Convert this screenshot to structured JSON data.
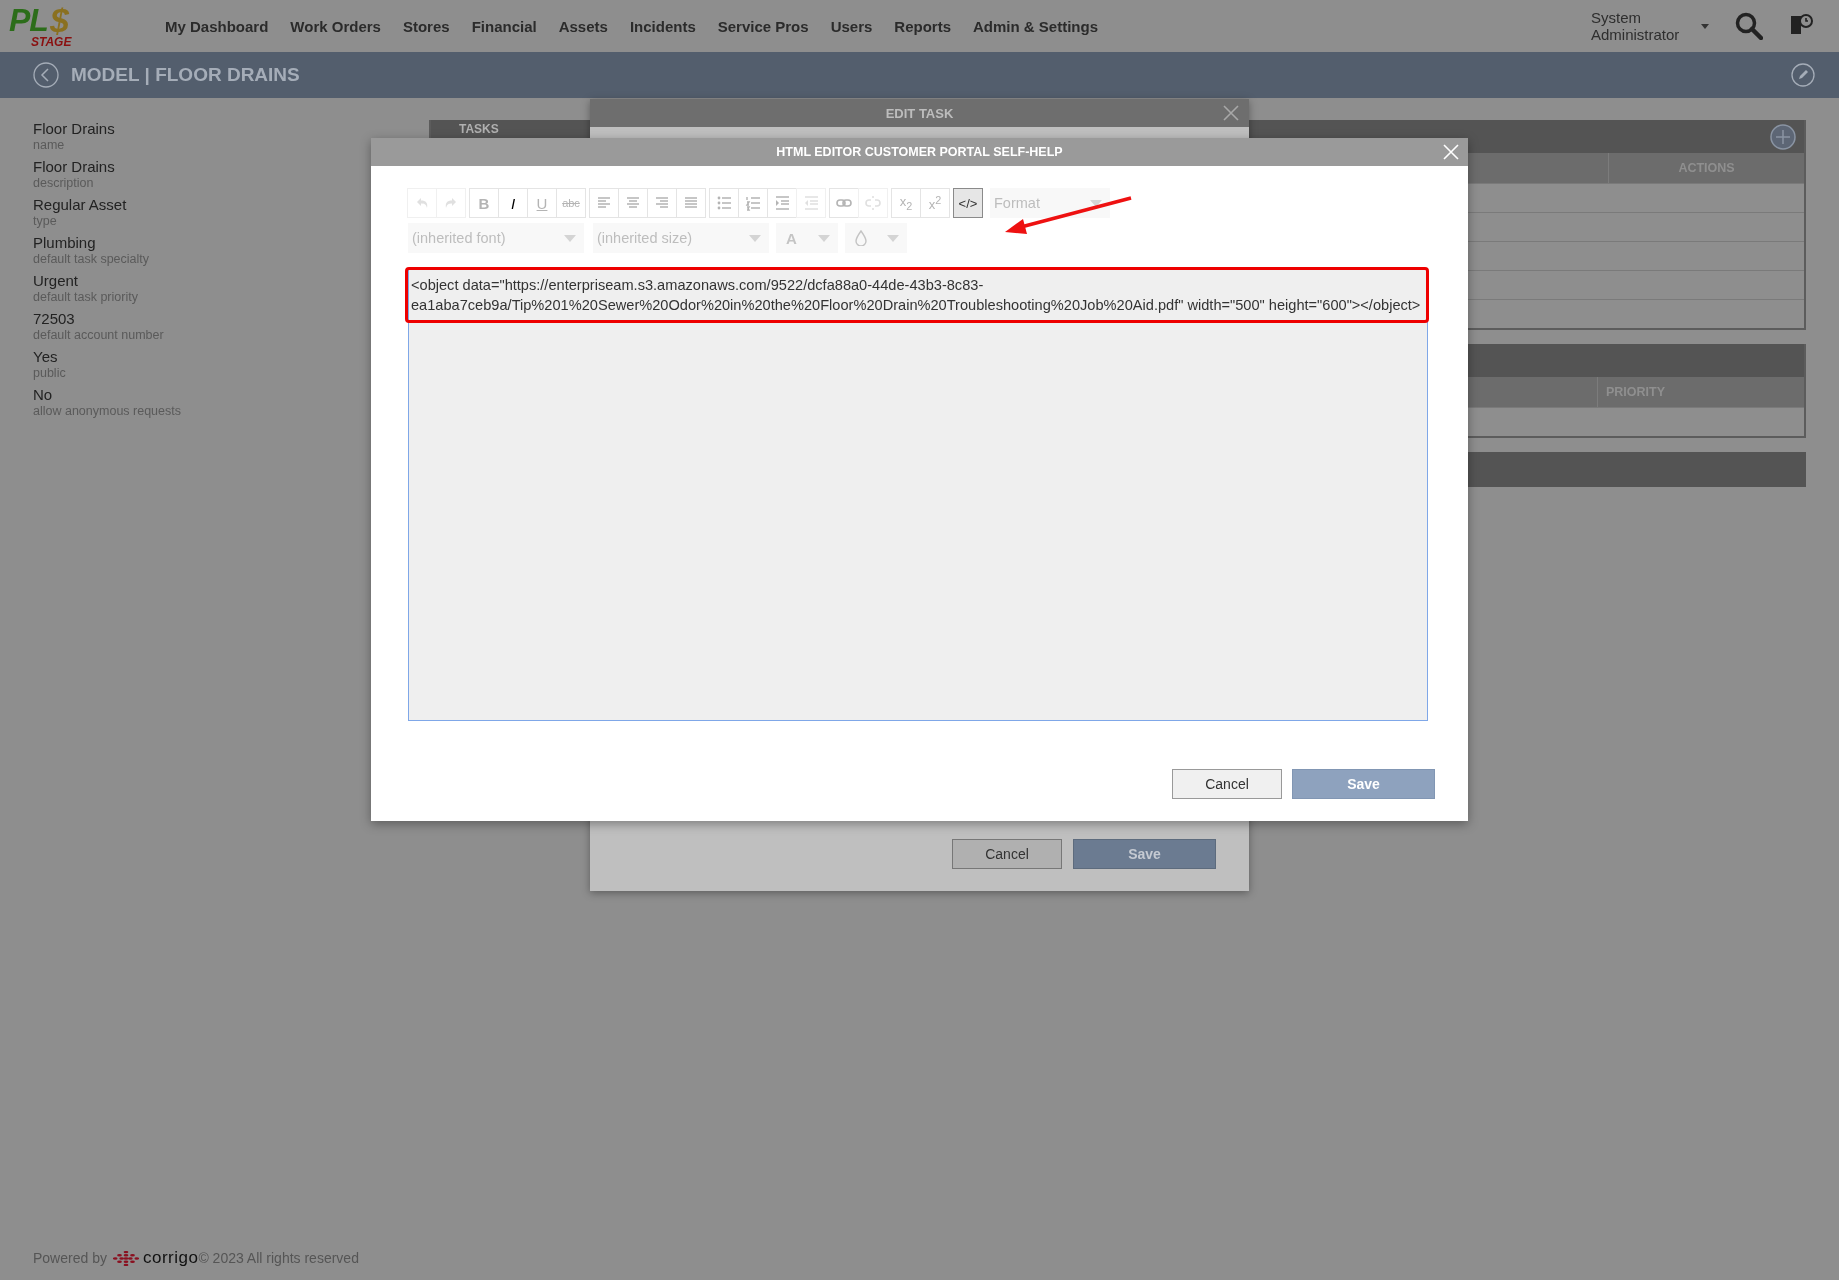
{
  "nav": {
    "logo": {
      "letters": "PL",
      "symbol": "$",
      "badge": "STAGE"
    },
    "items": [
      "My Dashboard",
      "Work Orders",
      "Stores",
      "Financial",
      "Assets",
      "Incidents",
      "Service Pros",
      "Users",
      "Reports",
      "Admin & Settings"
    ],
    "user": "System Administrator"
  },
  "header": {
    "title": "MODEL | FLOOR DRAINS"
  },
  "details": [
    {
      "value": "Floor Drains",
      "label": "name"
    },
    {
      "value": "Floor Drains",
      "label": "description"
    },
    {
      "value": "Regular Asset",
      "label": "type"
    },
    {
      "value": "Plumbing",
      "label": "default task specialty"
    },
    {
      "value": "Urgent",
      "label": "default task priority"
    },
    {
      "value": "72503",
      "label": "default account number"
    },
    {
      "value": "Yes",
      "label": "public"
    },
    {
      "value": "No",
      "label": "allow anonymous requests"
    }
  ],
  "panels": [
    {
      "kind": "table",
      "heading": "TASKS",
      "column": "ACTIONS"
    },
    {
      "kind": "table",
      "column": "PRIORITY"
    },
    {
      "kind": "bar"
    }
  ],
  "edit_task": {
    "title": "EDIT TASK",
    "buttons": [
      {
        "label": "Cancel",
        "kind": "secondary"
      },
      {
        "label": "Save",
        "kind": "primary"
      }
    ]
  },
  "html_editor": {
    "title": "HTML EDITOR CUSTOMER PORTAL SELF-HELP",
    "toolbar": [
      [
        {
          "kind": "group",
          "buttons": [
            {
              "kind": "undo",
              "disabled": true,
              "selected": false
            },
            {
              "kind": "redo",
              "disabled": true,
              "selected": false
            }
          ]
        },
        {
          "kind": "group",
          "buttons": [
            {
              "kind": "bold",
              "label": "B",
              "disabled": false,
              "selected": false
            },
            {
              "kind": "italic",
              "label": "I",
              "disabled": false,
              "selected": false
            },
            {
              "kind": "underline",
              "label": "U",
              "disabled": false,
              "selected": false
            },
            {
              "kind": "strike",
              "label": "abc",
              "disabled": false,
              "selected": false
            }
          ]
        },
        {
          "kind": "group",
          "buttons": [
            {
              "kind": "align-left",
              "disabled": false,
              "selected": false
            },
            {
              "kind": "align-center",
              "disabled": false,
              "selected": false
            },
            {
              "kind": "align-right",
              "disabled": false,
              "selected": false
            },
            {
              "kind": "justify",
              "disabled": false,
              "selected": false
            }
          ]
        },
        {
          "kind": "group",
          "buttons": [
            {
              "kind": "bullet-list",
              "disabled": false,
              "selected": false
            },
            {
              "kind": "numbered-list",
              "disabled": false,
              "selected": false
            },
            {
              "kind": "indent",
              "disabled": false,
              "selected": false
            },
            {
              "kind": "outdent",
              "disabled": true,
              "selected": false
            }
          ]
        },
        {
          "kind": "group",
          "buttons": [
            {
              "kind": "link",
              "disabled": false,
              "selected": false
            },
            {
              "kind": "unlink",
              "disabled": true,
              "selected": false
            }
          ]
        },
        {
          "kind": "group",
          "buttons": [
            {
              "kind": "subscript",
              "label": "x$_{2}$",
              "disabled": false,
              "selected": false
            },
            {
              "kind": "superscript",
              "label": "x$^{2}$",
              "disabled": false,
              "selected": false
            }
          ]
        },
        {
          "kind": "group",
          "buttons": [
            {
              "kind": "code",
              "label": "</>",
              "disabled": false,
              "selected": true
            }
          ]
        },
        {
          "kind": "dropdown",
          "label": "Format"
        }
      ],
      [
        {
          "kind": "dropdown",
          "label": "(inherited font)"
        },
        {
          "kind": "dropdown",
          "label": "(inherited size)"
        },
        {
          "kind": "text-color",
          "label": "A"
        },
        {
          "kind": "fill-color"
        }
      ]
    ],
    "content": "<object data=\"https://enterpriseam.s3.amazonaws.com/9522/dcfa88a0-44de-43b3-8c83-ea1aba7ceb9a/Tip%201%20Sewer%20Odor%20in%20the%20Floor%20Drain%20Troubleshooting%20Job%20Aid.pdf\" width=\"500\" height=\"600\"></object>",
    "buttons": [
      {
        "label": "Cancel",
        "kind": "secondary"
      },
      {
        "label": "Save",
        "kind": "primary"
      }
    ]
  },
  "footer": {
    "powered_by": "Powered by",
    "brand": "corrigo",
    "copyright": "© 2023 All rights reserved"
  }
}
